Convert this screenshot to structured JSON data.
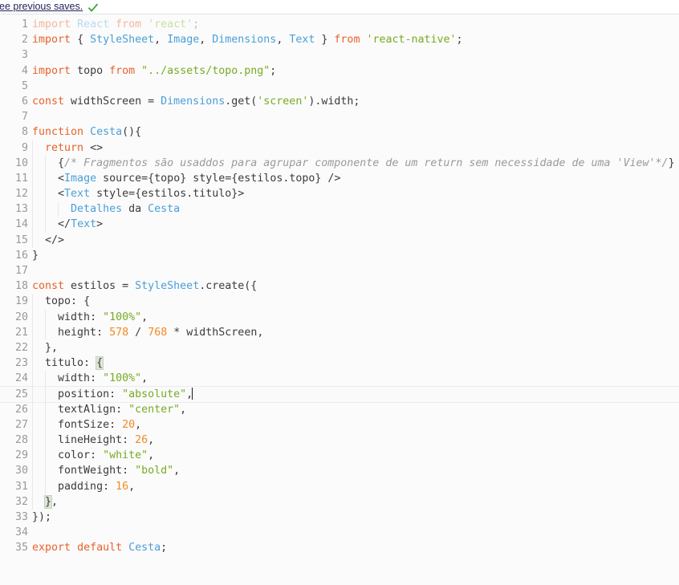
{
  "topbar": {
    "link_text": "ee previous saves.",
    "status_icon": "green-check-icon"
  },
  "editor": {
    "language": "javascript",
    "active_line": 25,
    "cursor": {
      "line": 25,
      "column": 24
    },
    "total_lines": 35,
    "colors": {
      "background": "#fbfbfb",
      "gutter_text": "#999999",
      "keyword": "#e8622b",
      "class_name": "#4a9fd8",
      "string": "#77ab23",
      "number": "#f08a24",
      "plain": "#3b3b3b",
      "comment": "#9a9a9a",
      "active_line": "#fafafa",
      "bracket_match": "#dfe6d8",
      "link": "#25215e",
      "check": "#3aa33a"
    },
    "line_numbers": [
      "1",
      "2",
      "3",
      "4",
      "5",
      "6",
      "7",
      "8",
      "9",
      "10",
      "11",
      "12",
      "13",
      "14",
      "15",
      "16",
      "17",
      "18",
      "19",
      "20",
      "21",
      "22",
      "23",
      "24",
      "25",
      "26",
      "27",
      "28",
      "29",
      "30",
      "31",
      "32",
      "33",
      "34",
      "35"
    ],
    "code_lines": [
      "import React from 'react';",
      "import { StyleSheet, Image, Dimensions, Text } from 'react-native';",
      "",
      "import topo from \"../assets/topo.png\";",
      "",
      "const widthScreen = Dimensions.get('screen').width;",
      "",
      "function Cesta(){",
      "  return <>",
      "    {/* Fragmentos são usaddos para agrupar componente de um return sem necessidade de uma 'View'*/}",
      "    <Image source={topo} style={estilos.topo} />",
      "    <Text style={estilos.titulo}>",
      "      Detalhes da Cesta",
      "    </Text>",
      "  </>",
      "}",
      "",
      "const estilos = StyleSheet.create({",
      "  topo: {",
      "    width: \"100%\",",
      "    height: 578 / 768 * widthScreen,",
      "  },",
      "  titulo: {",
      "    width: \"100%\",",
      "    position: \"absolute\",",
      "    textAlign: \"center\",",
      "    fontSize: 20,",
      "    lineHeight: 26,",
      "    color: \"white\",",
      "    fontWeight: \"bold\",",
      "    padding: 16,",
      "  },",
      "});",
      "",
      "export default Cesta;"
    ]
  }
}
